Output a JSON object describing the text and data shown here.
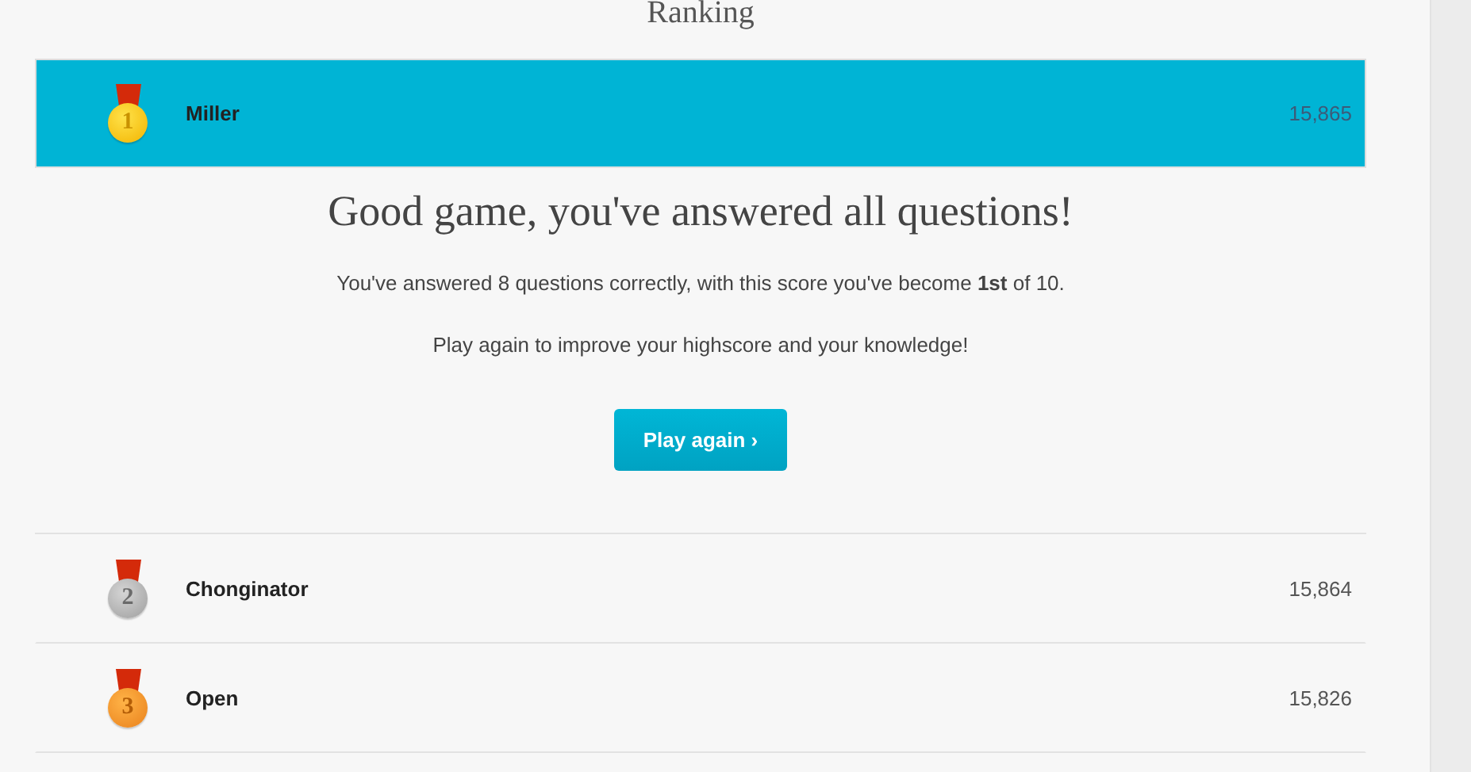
{
  "title": "Ranking",
  "rows": [
    {
      "rank": "1",
      "kind": "gold",
      "name": "Miller",
      "score": "15,865",
      "selected": true
    },
    {
      "rank": "2",
      "kind": "silver",
      "name": "Chonginator",
      "score": "15,864",
      "selected": false
    },
    {
      "rank": "3",
      "kind": "bronze",
      "name": "Open",
      "score": "15,826",
      "selected": false
    }
  ],
  "result": {
    "heading": "Good game, you've answered all questions!",
    "summary": "You've answered 8 questions correctly, with this score you've become **1st** of 10.",
    "hint": "Play again to improve your highscore and your knowledge!",
    "button": "Play again ›"
  }
}
